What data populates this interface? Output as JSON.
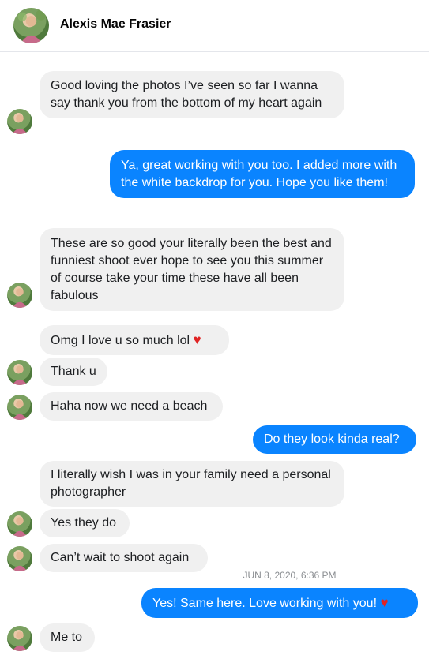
{
  "header": {
    "name": "Alexis Mae Frasier"
  },
  "messages": [
    {
      "text": "Good loving the photos I’ve seen so far I wanna say thank you from the bottom of my heart again"
    },
    {
      "text": "Ya, great working with you too.  I added more with the white backdrop for you.  Hope you like them!"
    },
    {
      "text": "These are so good your literally been the best and funniest shoot ever hope to see you this summer of course take your time these have all been fabulous"
    },
    {
      "text": "Omg I love u so much lol",
      "emoji": "♥"
    },
    {
      "text": "Thank u"
    },
    {
      "text": "Haha now we need a beach"
    },
    {
      "text": "Do they look kinda real?"
    },
    {
      "text": "I literally wish I was in your family need a personal photographer"
    },
    {
      "text": "Yes they do"
    },
    {
      "text": "Can’t wait to shoot again"
    },
    {
      "text": "Yes!  Same here. Love working with you!",
      "emoji": "♥"
    },
    {
      "text": "Me to"
    }
  ],
  "timestamp": "JUN 8, 2020, 6:36 PM",
  "colors": {
    "incoming": "#f0f0f0",
    "outgoing": "#0a84ff",
    "heart": "#e02424"
  }
}
